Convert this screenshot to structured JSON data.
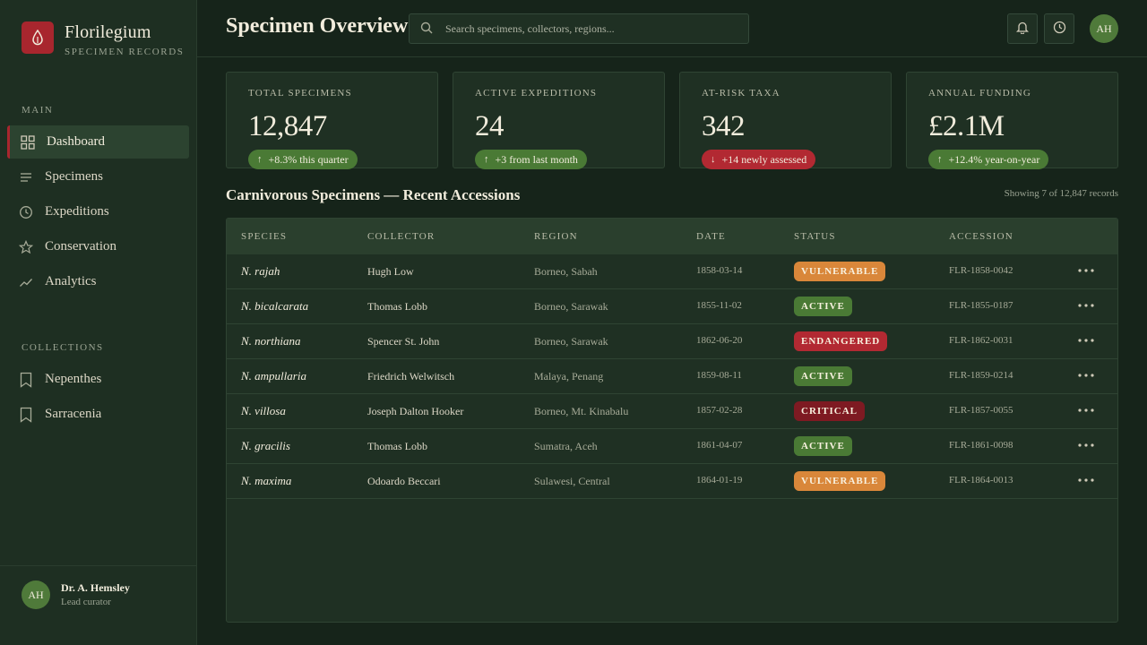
{
  "brand": {
    "name": "Florilegium",
    "subtitle": "SPECIMEN RECORDS"
  },
  "nav": {
    "main_title": "MAIN",
    "main_items": [
      {
        "label": "Dashboard",
        "icon": "grid-icon",
        "active": true
      },
      {
        "label": "Specimens",
        "icon": "list-icon"
      },
      {
        "label": "Expeditions",
        "icon": "clock-icon"
      },
      {
        "label": "Conservation",
        "icon": "star-icon"
      },
      {
        "label": "Analytics",
        "icon": "trend-icon"
      }
    ],
    "collections_title": "COLLECTIONS",
    "collection_items": [
      {
        "label": "Nepenthes",
        "icon": "bookmark-icon"
      },
      {
        "label": "Sarracenia",
        "icon": "bookmark-icon"
      }
    ]
  },
  "user": {
    "initials": "AH",
    "name": "Dr. A. Hemsley",
    "role": "Lead curator"
  },
  "header": {
    "title": "Specimen Overview",
    "search_placeholder": "Search specimens, collectors, regions...",
    "search_value": ""
  },
  "stats": [
    {
      "label": "TOTAL SPECIMENS",
      "value": "12,847",
      "trend": "+8.3% this quarter",
      "direction": "up"
    },
    {
      "label": "ACTIVE EXPEDITIONS",
      "value": "24",
      "trend": "+3 from last month",
      "direction": "up"
    },
    {
      "label": "AT-RISK TAXA",
      "value": "342",
      "trend": "+14 newly assessed",
      "direction": "down"
    },
    {
      "label": "ANNUAL FUNDING",
      "value": "£2.1M",
      "trend": "+12.4% year-on-year",
      "direction": "up"
    }
  ],
  "table": {
    "title": "Carnivorous Specimens — Recent Accessions",
    "meta": "Showing 7 of 12,847 records",
    "columns": [
      "SPECIES",
      "COLLECTOR",
      "REGION",
      "DATE",
      "STATUS",
      "ACCESSION"
    ],
    "rows": [
      {
        "species": "N. rajah",
        "collector": "Hugh Low",
        "region": "Borneo, Sabah",
        "date": "1858-03-14",
        "status": "VULNERABLE",
        "accession": "FLR-1858-0042"
      },
      {
        "species": "N. bicalcarata",
        "collector": "Thomas Lobb",
        "region": "Borneo, Sarawak",
        "date": "1855-11-02",
        "status": "ACTIVE",
        "accession": "FLR-1855-0187"
      },
      {
        "species": "N. northiana",
        "collector": "Spencer St. John",
        "region": "Borneo, Sarawak",
        "date": "1862-06-20",
        "status": "ENDANGERED",
        "accession": "FLR-1862-0031"
      },
      {
        "species": "N. ampullaria",
        "collector": "Friedrich Welwitsch",
        "region": "Malaya, Penang",
        "date": "1859-08-11",
        "status": "ACTIVE",
        "accession": "FLR-1859-0214"
      },
      {
        "species": "N. villosa",
        "collector": "Joseph Dalton Hooker",
        "region": "Borneo, Mt. Kinabalu",
        "date": "1857-02-28",
        "status": "CRITICAL",
        "accession": "FLR-1857-0055"
      },
      {
        "species": "N. gracilis",
        "collector": "Thomas Lobb",
        "region": "Sumatra, Aceh",
        "date": "1861-04-07",
        "status": "ACTIVE",
        "accession": "FLR-1861-0098"
      },
      {
        "species": "N. maxima",
        "collector": "Odoardo Beccari",
        "region": "Sulawesi, Central",
        "date": "1864-01-19",
        "status": "VULNERABLE",
        "accession": "FLR-1864-0013"
      }
    ]
  },
  "colors": {
    "accent": "#a8262e",
    "status_active": "#4a7a35",
    "status_vulnerable": "#d9873a",
    "status_endangered": "#b22932",
    "status_critical": "#7e1a22"
  }
}
